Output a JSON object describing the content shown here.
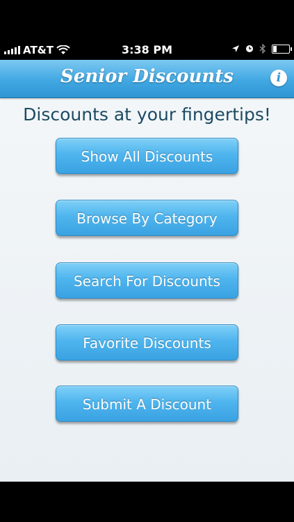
{
  "status_bar": {
    "carrier": "AT&T",
    "time": "3:38 PM"
  },
  "nav": {
    "title": "Senior Discounts",
    "info_label": "i"
  },
  "main": {
    "tagline": "Discounts at your fingertips!",
    "buttons": [
      {
        "label": "Show All Discounts"
      },
      {
        "label": "Browse By Category"
      },
      {
        "label": "Search For Discounts"
      },
      {
        "label": "Favorite Discounts"
      },
      {
        "label": "Submit A Discount"
      }
    ]
  },
  "colors": {
    "accent": "#3aa2e2",
    "tagline": "#1d4a63",
    "background": "#eef3f6"
  },
  "icons": [
    "signal-icon",
    "wifi-icon",
    "location-icon",
    "alarm-icon",
    "bluetooth-icon",
    "battery-icon",
    "info-icon"
  ]
}
